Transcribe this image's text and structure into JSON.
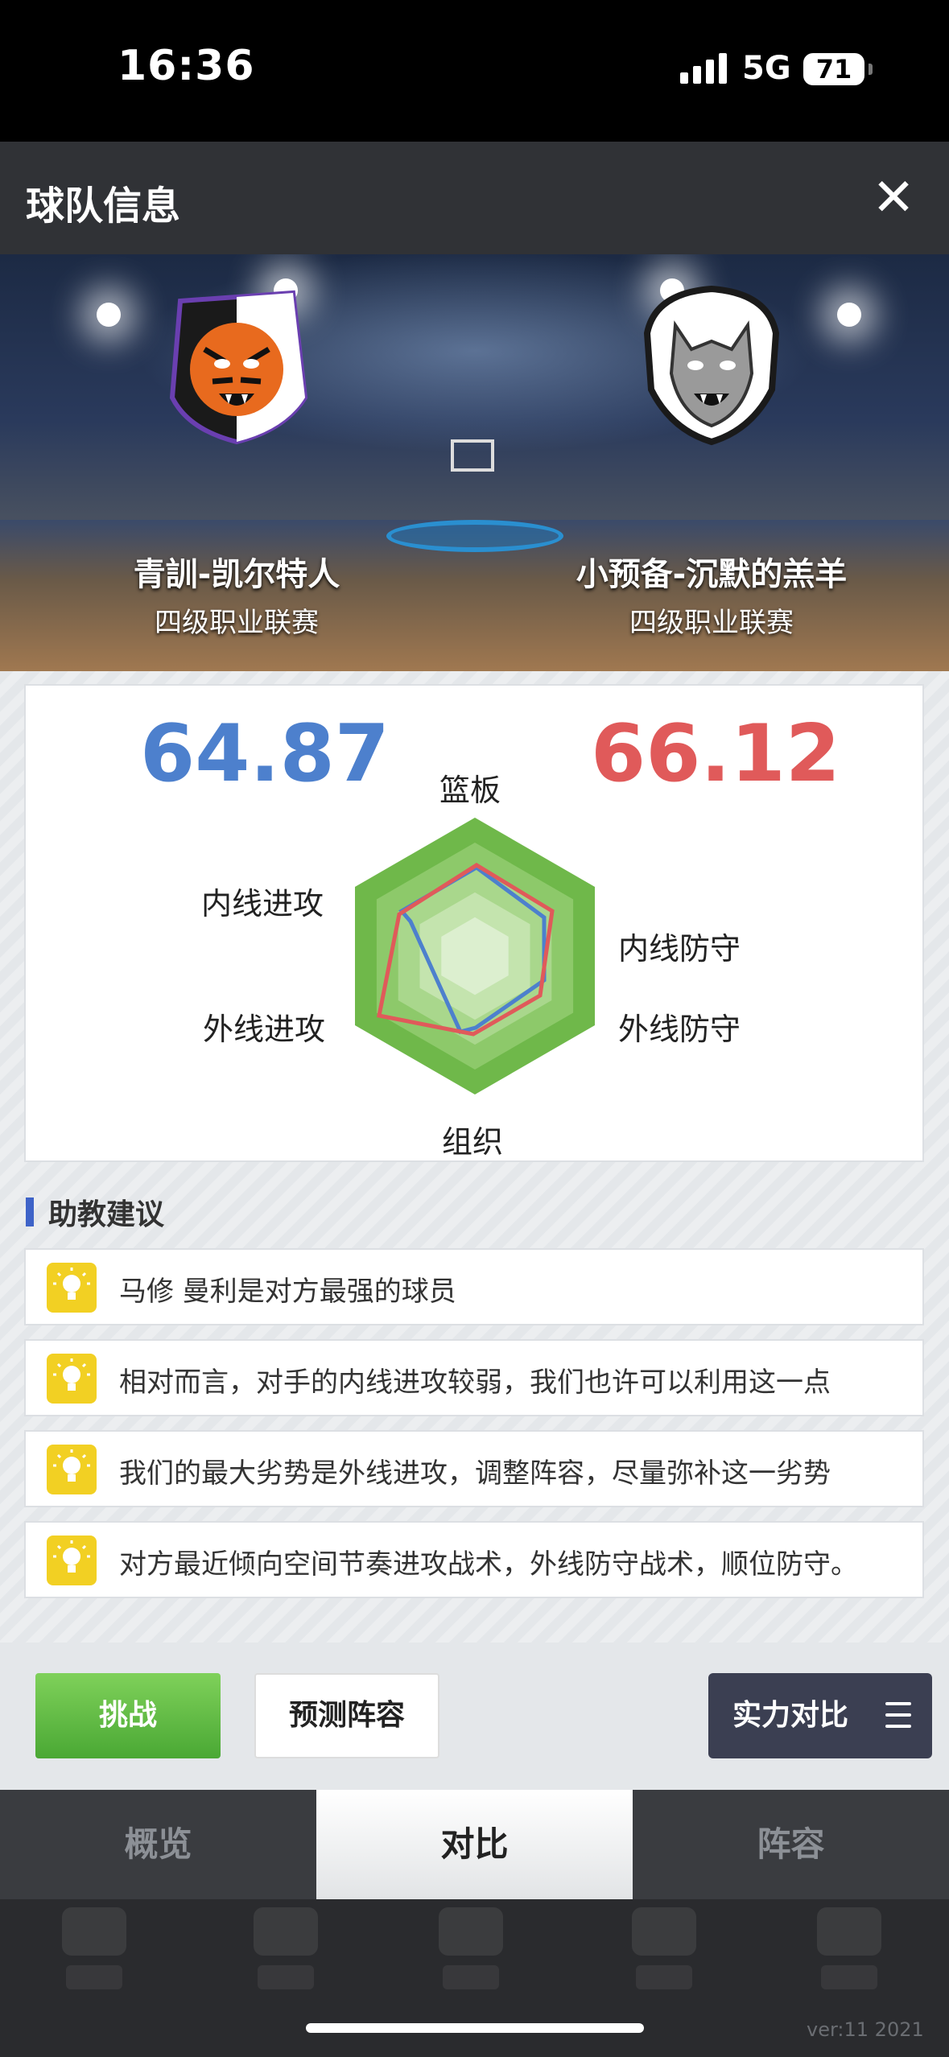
{
  "status_bar": {
    "time": "16:36",
    "network": "5G",
    "battery": "71"
  },
  "header": {
    "title": "球队信息"
  },
  "teams": {
    "home": {
      "name": "青訓-凯尔特人",
      "league": "四级职业联赛",
      "score": "64.87",
      "color": "#4d80cd"
    },
    "away": {
      "name": "小预备-沉默的羔羊",
      "league": "四级职业联赛",
      "score": "66.12",
      "color": "#e05a5a"
    }
  },
  "radar": {
    "axes": [
      "篮板",
      "内线防守",
      "外线防守",
      "组织",
      "外线进攻",
      "内线进攻"
    ]
  },
  "advice": {
    "title": "助教建议",
    "tips": [
      "马修 曼利是对方最强的球员",
      "相对而言，对手的内线进攻较弱，我们也许可以利用这一点",
      "我们的最大劣势是外线进攻，调整阵容，尽量弥补这一劣势",
      "对方最近倾向空间节奏进攻战术，外线防守战术，顺位防守。"
    ]
  },
  "actions": {
    "challenge": "挑战",
    "predict": "预测阵容",
    "compare": "实力对比"
  },
  "tabs": [
    "概览",
    "对比",
    "阵容"
  ],
  "footer": {
    "version": "ver:11  2021"
  }
}
